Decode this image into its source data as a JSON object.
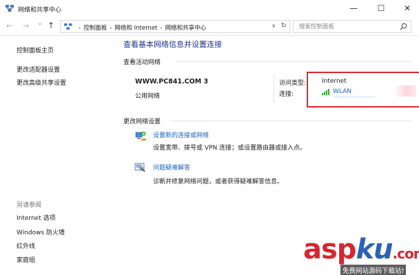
{
  "window": {
    "title": "网络和共享中心",
    "minimize_glyph": "—",
    "maximize_glyph": "☐",
    "close_glyph": "✕"
  },
  "address_bar": {
    "back_glyph": "←",
    "forward_glyph": "→",
    "recent_glyph": "∨",
    "up_glyph": "↑",
    "breadcrumbs": [
      "控制面板",
      "网络和 Internet",
      "网络和共享中心"
    ],
    "separator": "›",
    "dropdown_glyph": "∨",
    "refresh_glyph": "↻",
    "search_placeholder": "搜索控制面板"
  },
  "sidebar": {
    "links": [
      "控制面板主页",
      "更改适配器设置",
      "更改高级共享设置"
    ],
    "see_also_heading": "另请参阅",
    "see_also": [
      "Internet 选项",
      "Windows 防火墙",
      "红外线",
      "家庭组"
    ]
  },
  "main": {
    "title": "查看基本网络信息并设置连接",
    "active_networks_heading": "查看活动网络",
    "network": {
      "name": "WWW.PC841.COM  3",
      "type": "公用网络",
      "access_type_label": "访问类型:",
      "access_type_value": "Internet",
      "connections_label": "连接:",
      "connection_value": "WLAN"
    },
    "change_settings_heading": "更改网络设置",
    "tasks": [
      {
        "icon": "network-setup-icon",
        "link": "设置新的连接或网络",
        "description": "设置宽带、拨号或 VPN 连接；或设置路由器或接入点。"
      },
      {
        "icon": "troubleshoot-icon",
        "link": "问题疑难解答",
        "description": "诊断并修复网络问题，或者获得疑难解答信息。"
      }
    ]
  },
  "watermark": {
    "logo_part1": "asp",
    "logo_part2": "ku",
    "logo_part3": ".com",
    "subtitle": "免费网站源码下载站!"
  },
  "colors": {
    "link": "#1a62c4",
    "title": "#1e3287",
    "highlight_box": "#e0242c",
    "signal": "#3aa23a"
  }
}
